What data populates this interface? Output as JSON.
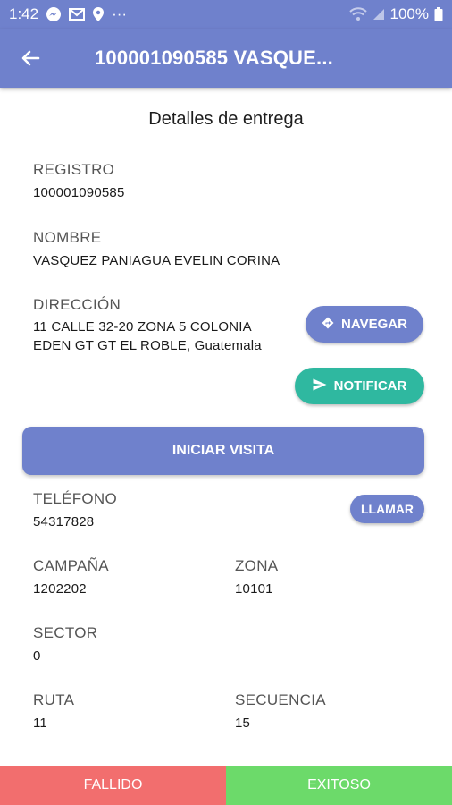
{
  "status_bar": {
    "time": "1:42",
    "battery": "100%",
    "more": "···"
  },
  "app_bar": {
    "title": "100001090585 VASQUE..."
  },
  "page": {
    "section_title": "Detalles de entrega"
  },
  "fields": {
    "registro": {
      "label": "REGISTRO",
      "value": "100001090585"
    },
    "nombre": {
      "label": "NOMBRE",
      "value": "VASQUEZ PANIAGUA EVELIN CORINA"
    },
    "direccion": {
      "label": "DIRECCIÓN",
      "line1": "11 CALLE 32-20 ZONA 5 COLONIA",
      "line2": "EDEN GT GT EL ROBLE, Guatemala"
    },
    "telefono": {
      "label": "TELÉFONO",
      "value": "54317828"
    },
    "campana": {
      "label": "CAMPAÑA",
      "value": "1202202"
    },
    "zona": {
      "label": "ZONA",
      "value": "10101"
    },
    "sector": {
      "label": "SECTOR",
      "value": "0"
    },
    "ruta": {
      "label": "RUTA",
      "value": "11"
    },
    "secuencia": {
      "label": "SECUENCIA",
      "value": "15"
    }
  },
  "buttons": {
    "navegar": "NAVEGAR",
    "notificar": "NOTIFICAR",
    "iniciar_visita": "INICIAR VISITA",
    "llamar": "LLAMAR",
    "fallido": "FALLIDO",
    "exitoso": "EXITOSO"
  },
  "colors": {
    "primary": "#6f81cc",
    "teal": "#2fb8a0",
    "fail": "#f26e6e",
    "success": "#6cda6a"
  },
  "icons": {
    "back": "arrow-left-icon",
    "navigate": "directions-diamond-icon",
    "send": "send-icon"
  }
}
